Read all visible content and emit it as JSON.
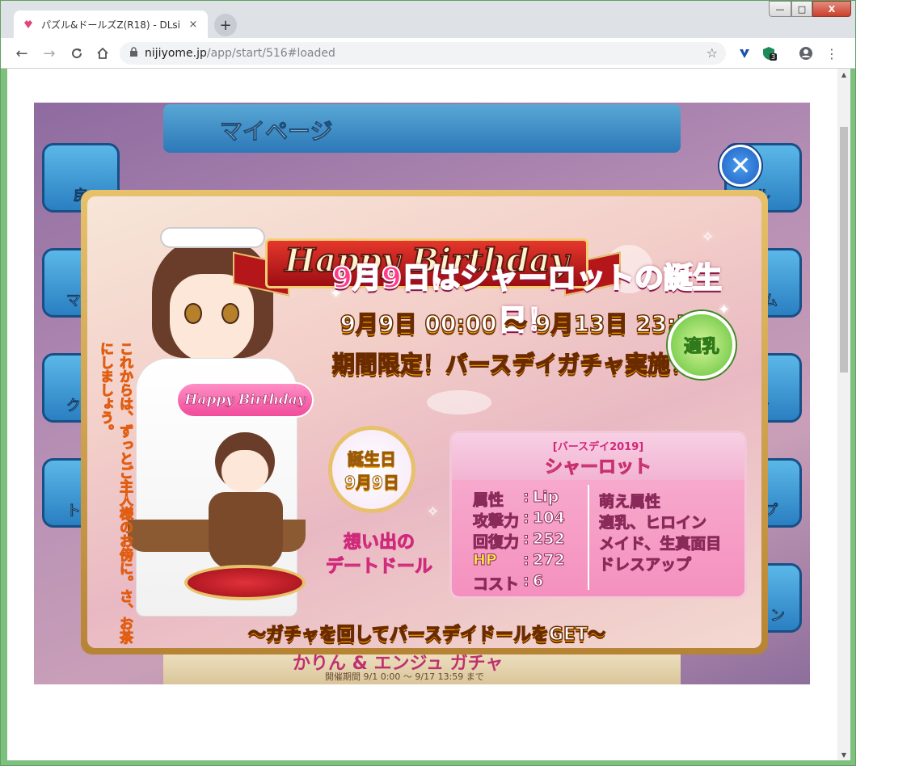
{
  "browser": {
    "tab_title": "パズル&ドールズZ(R18) - DLsi",
    "tab_close": "×",
    "newtab": "+",
    "url_host": "nijiyome.jp",
    "url_path": "/app/start/516#loaded",
    "ext_badge": "3",
    "win": {
      "min": "—",
      "max": "□",
      "close": "X"
    }
  },
  "game_bg": {
    "page_title": "マイページ",
    "side_left": [
      "戻",
      "マイ",
      "クエ",
      "トレ"
    ],
    "side_right": [
      "ル",
      "ズム",
      "ャ",
      "ップ",
      "ション"
    ],
    "banner_title": "かりん & エンジュ ガチャ",
    "banner_period": "開催期間  9/1 0:00 ～ 9/17 13:59 まで"
  },
  "popup": {
    "ribbon": "Happy Birthday",
    "headline": "9月9日はシャーロットの誕生日！",
    "period": "9月9日 00:00 ～ 9月13日 23:59",
    "announce": "期間限定！バースデイガチャ実施！！",
    "vertical_message": "これからは、ずっとご主人様のお傍に。さ、お茶にしましょう。",
    "chibi_banner": "Happy Birthday",
    "birthday_badge": {
      "line1": "誕生日",
      "line2": "9月9日"
    },
    "memory_label": {
      "line1": "想い出の",
      "line2": "デートドール"
    },
    "card": {
      "series": "[バースデイ2019]",
      "name": "シャーロット",
      "stats": [
        {
          "key": "属性",
          "value": "Lip"
        },
        {
          "key": "攻撃力",
          "value": "104"
        },
        {
          "key": "回復力",
          "value": "252"
        },
        {
          "key": "HP",
          "value": "272"
        },
        {
          "key": "コスト",
          "value": "6"
        }
      ],
      "moe_title": "萌え属性",
      "moe": [
        "適乳、ヒロイン",
        "メイド、生真面目",
        "ドレスアップ"
      ]
    },
    "type_badge": "適乳",
    "cta": "～ガチャを回してバースデイドールをGET～",
    "close": "✕"
  }
}
